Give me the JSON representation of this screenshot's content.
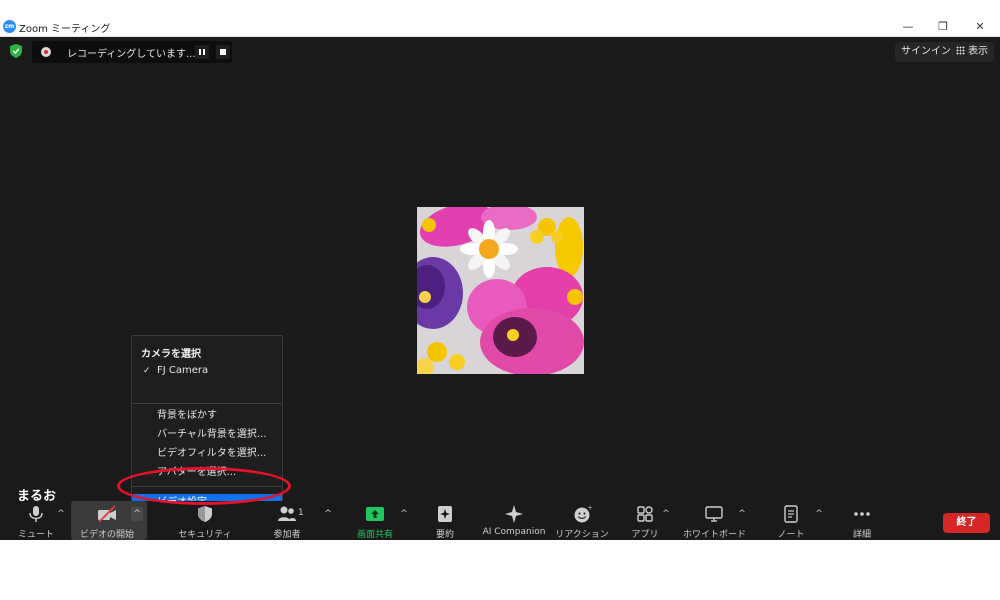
{
  "window": {
    "app_logo_text": "zm",
    "title": "Zoom ミーティング",
    "minimize_symbol": "—",
    "restore_symbol": "❐",
    "close_symbol": "✕"
  },
  "recording": {
    "status_text": "レコーディングしています..."
  },
  "top_right": {
    "signin_label": "サインイン",
    "view_label": "表示"
  },
  "participant": {
    "name": "まるお"
  },
  "camera_menu": {
    "header": "カメラを選択",
    "camera_name": "FJ Camera",
    "check": "✓",
    "items": [
      "背景をぼかす",
      "バーチャル背景を選択...",
      "ビデオフィルタを選択...",
      "アバターを選択..."
    ],
    "video_settings": "ビデオ設定..."
  },
  "toolbar": {
    "mute": "ミュート",
    "start_video": "ビデオの開始",
    "security": "セキュリティ",
    "participants": "参加者",
    "participant_count": "1",
    "share_screen": "画面共有",
    "summary": "要約",
    "ai_companion": "AI Companion",
    "reactions": "リアクション",
    "apps": "アプリ",
    "whiteboard": "ホワイトボード",
    "notes": "ノート",
    "more": "詳細",
    "caret": "^",
    "end": "終了"
  },
  "colors": {
    "accent": "#0e72ed",
    "share_green": "#22c55e",
    "end_red": "#d72626",
    "annotation_red": "#e8132a"
  }
}
